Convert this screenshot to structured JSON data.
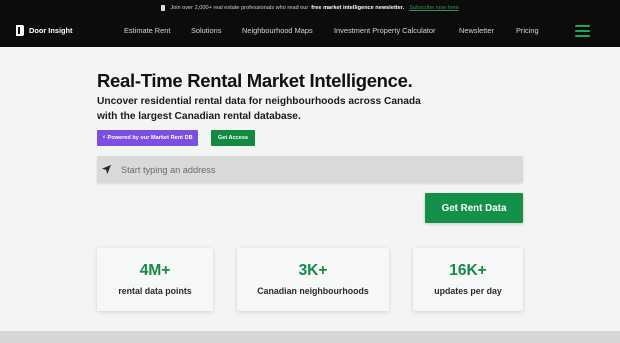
{
  "announcement": {
    "prefix": "Join over 2,000+ real estate professionals who read our",
    "highlight": "free market intelligence newsletter.",
    "link": "Subscribe now here"
  },
  "nav": {
    "brand": "Door Insight",
    "links": [
      "Estimate Rent",
      "Solutions",
      "Neighbourhood Maps",
      "Investment Property Calculator",
      "Newsletter",
      "Pricing"
    ]
  },
  "hero": {
    "title": "Real-Time Rental Market Intelligence.",
    "subtitle": "Uncover residential rental data for neighbourhoods across Canada with the largest Canadian rental database.",
    "badge_powered": "⚡ Powered by our Market Rent DB",
    "badge_access": "Get Access"
  },
  "search": {
    "placeholder": "Start typing an address",
    "value": ""
  },
  "cta": {
    "label": "Get Rent Data"
  },
  "stats": [
    {
      "value": "4M+",
      "label": "rental data points"
    },
    {
      "value": "3K+",
      "label": "Canadian neighbourhoods"
    },
    {
      "value": "16K+",
      "label": "updates per day"
    }
  ],
  "colors": {
    "brand_green": "#139149",
    "accent_purple": "#7b4fe0",
    "nav_bg": "#0c0c0c",
    "page_bg": "#f3f4f4"
  }
}
